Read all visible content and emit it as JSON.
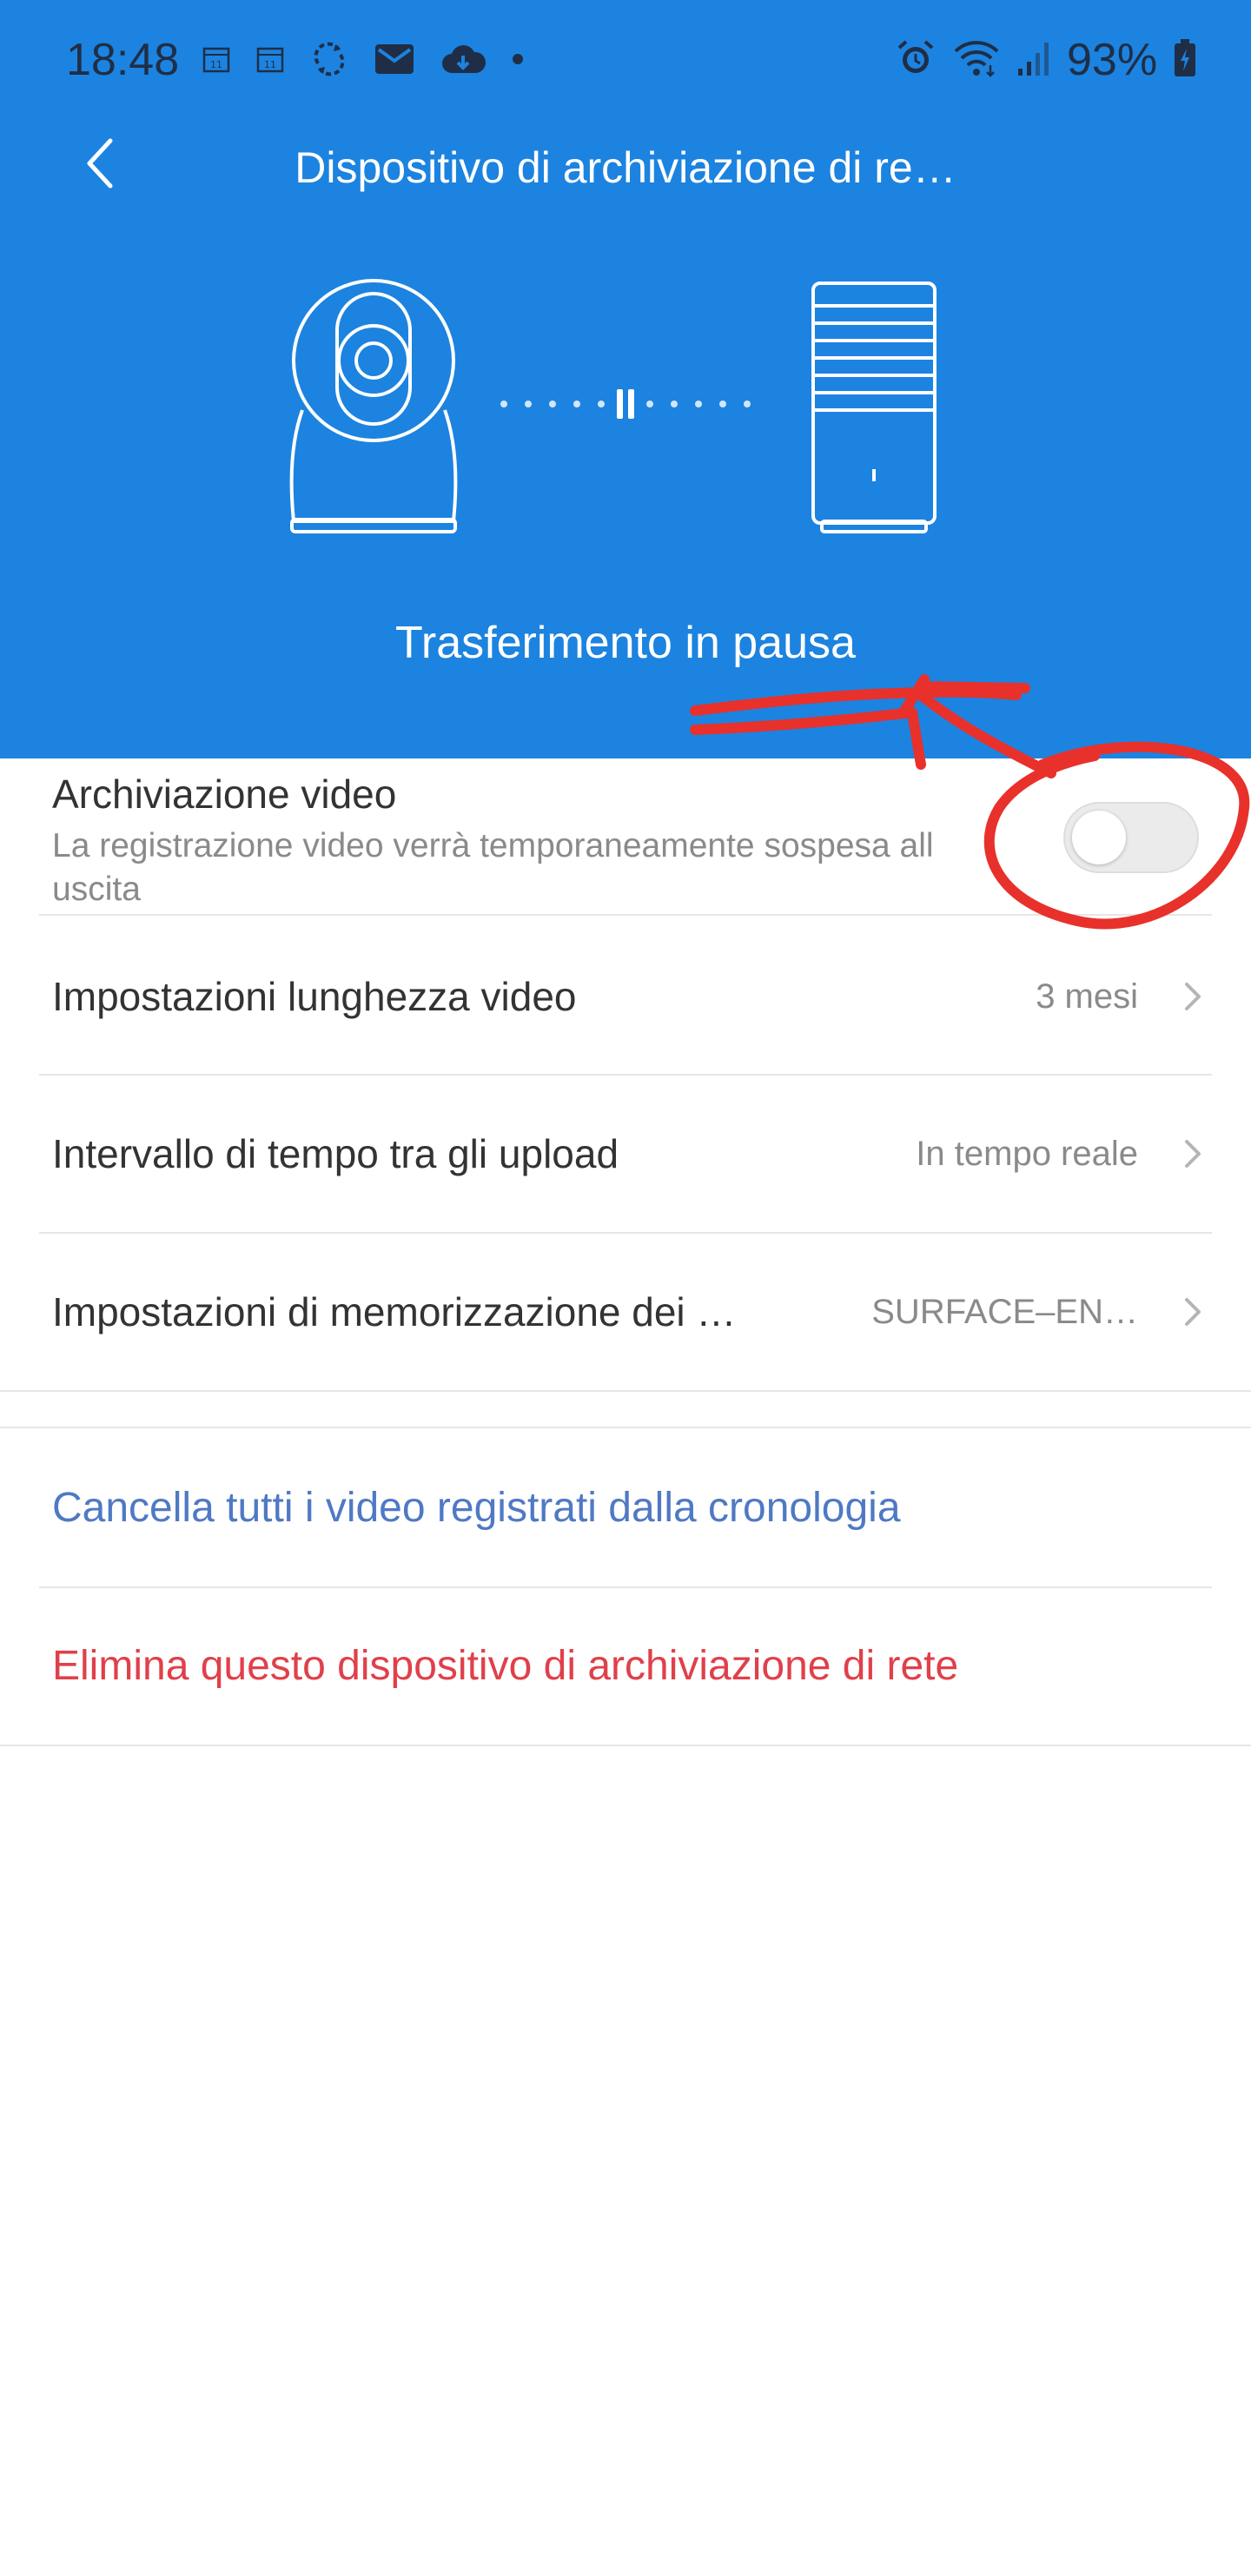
{
  "colors": {
    "header_bg": "#1C83E0",
    "status_text": "#1f2e46",
    "primary_text": "#333333",
    "secondary_text": "#8a8a8a",
    "link_blue": "#4F79C4",
    "danger_red": "#E0404A",
    "annotation_red": "#E8312B"
  },
  "status_bar": {
    "time": "18:48",
    "battery_percent": "93%",
    "left_icons": [
      "calendar-icon",
      "calendar-icon",
      "sync-icon",
      "mail-icon",
      "cloud-icon",
      "dot-icon"
    ],
    "right_icons": [
      "alarm-icon",
      "wifi-icon",
      "signal-icon",
      "battery-icon"
    ]
  },
  "header": {
    "title": "Dispositivo di archiviazione di re…",
    "back_icon": "chevron-left-icon",
    "transfer_status": "Trasferimento in pausa"
  },
  "storage_toggle": {
    "title": "Archiviazione video",
    "subtitle": "La registrazione video verrà temporaneamente sospesa all uscita",
    "enabled": false
  },
  "settings": [
    {
      "label": "Impostazioni lunghezza video",
      "value": "3 mesi"
    },
    {
      "label": "Intervallo di tempo tra gli upload",
      "value": "In tempo reale"
    },
    {
      "label": "Impostazioni di memorizzazione dei …",
      "value": "SURFACE–EN…"
    }
  ],
  "actions": {
    "clear_history": "Cancella tutti i video registrati dalla cronologia",
    "delete_device": "Elimina questo dispositivo di archiviazione di rete"
  }
}
